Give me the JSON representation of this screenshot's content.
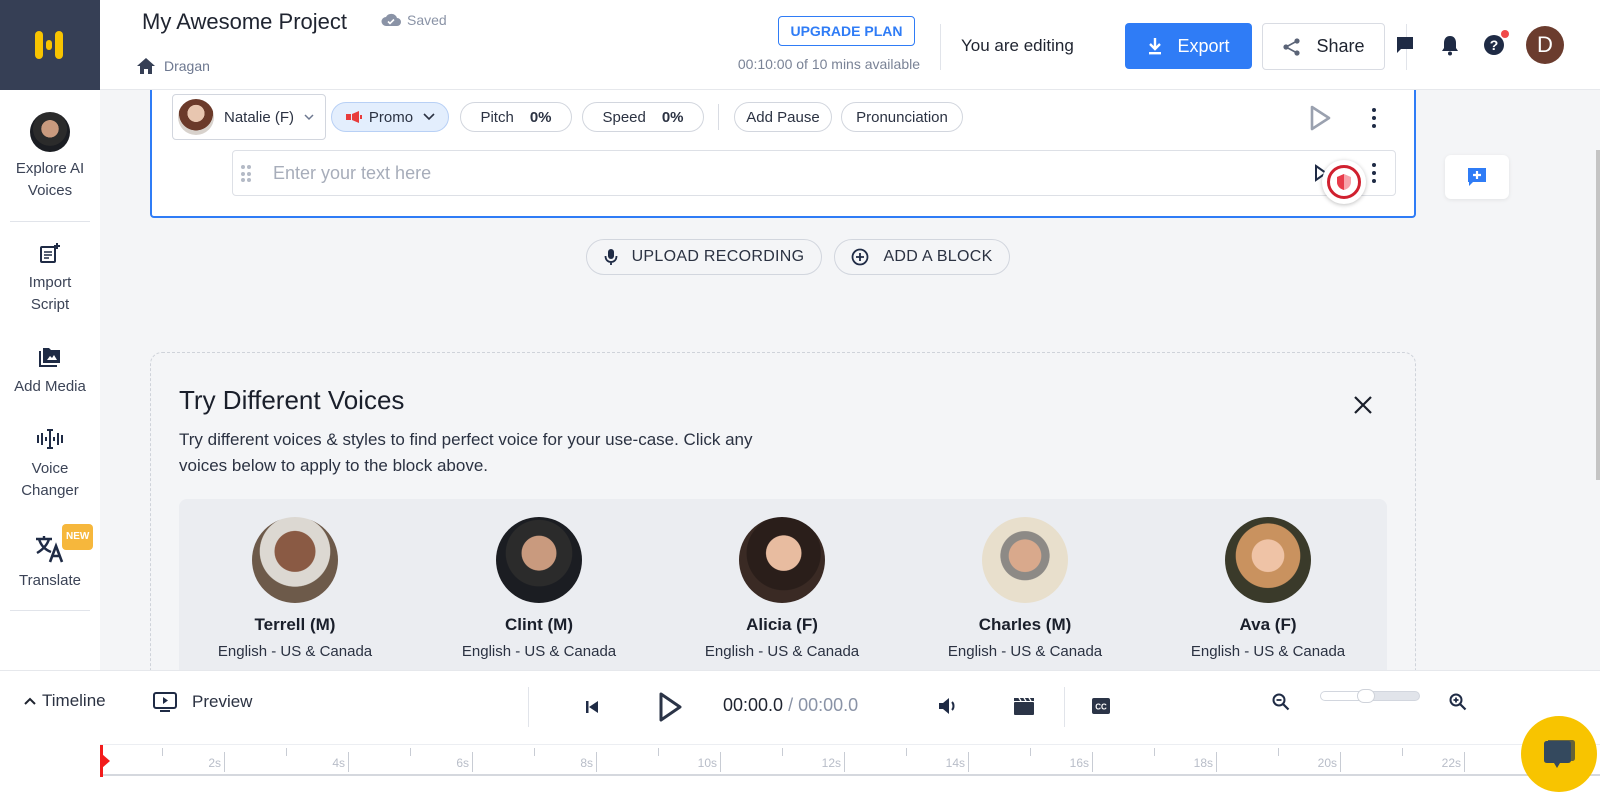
{
  "header": {
    "project_title": "My Awesome Project",
    "save_status": "Saved",
    "breadcrumb": "Dragan",
    "upgrade_label": "UPGRADE PLAN",
    "minutes_available": "00:10:00 of 10 mins available",
    "editing_status": "You are editing",
    "export_label": "Export",
    "share_label": "Share",
    "avatar_initial": "D",
    "accent_color": "#2f7cf6"
  },
  "sidebar": {
    "items": [
      {
        "label": "Explore AI Voices",
        "icon": "voice-avatar-icon"
      },
      {
        "label": "Import Script",
        "icon": "import-script-icon"
      },
      {
        "label": "Add Media",
        "icon": "add-media-icon"
      },
      {
        "label": "Voice Changer",
        "icon": "voice-changer-icon"
      },
      {
        "label": "Translate",
        "icon": "translate-icon",
        "badge": "NEW"
      }
    ]
  },
  "block": {
    "voice": "Natalie (F)",
    "style": "Promo",
    "pitch_label": "Pitch",
    "pitch_value": "0%",
    "speed_label": "Speed",
    "speed_value": "0%",
    "add_pause_label": "Add Pause",
    "pronunciation_label": "Pronunciation",
    "text_placeholder": "Enter your text here"
  },
  "actions": {
    "upload_label": "UPLOAD RECORDING",
    "add_block_label": "ADD A BLOCK"
  },
  "try_voices": {
    "title": "Try Different Voices",
    "description": "Try different voices & styles to find perfect voice for your use-case. Click any voices below to apply to the block above.",
    "voices": [
      {
        "name": "Terrell (M)",
        "language": "English - US & Canada"
      },
      {
        "name": "Clint (M)",
        "language": "English - US & Canada"
      },
      {
        "name": "Alicia (F)",
        "language": "English - US & Canada"
      },
      {
        "name": "Charles (M)",
        "language": "English - US & Canada"
      },
      {
        "name": "Ava (F)",
        "language": "English - US & Canada"
      }
    ]
  },
  "player": {
    "timeline_label": "Timeline",
    "preview_label": "Preview",
    "current_time": "00:00.0",
    "total_time": "/ 00:00.0",
    "zoom_level": 0.45,
    "ruler_labels": [
      "2s",
      "4s",
      "6s",
      "8s",
      "10s",
      "12s",
      "14s",
      "16s",
      "18s",
      "20s",
      "22s"
    ]
  }
}
